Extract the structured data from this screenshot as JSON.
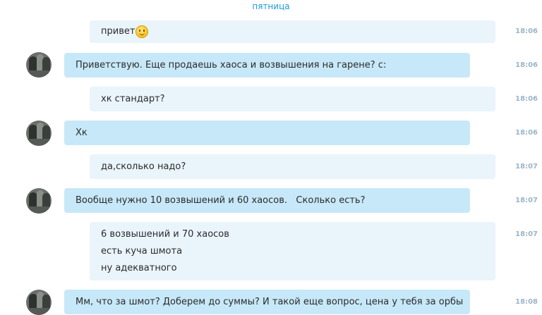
{
  "chat": {
    "date_separator": "пятница",
    "messages": [
      {
        "sender": "me",
        "lines": [
          "привет"
        ],
        "emoji": "smiley-emoji",
        "time": "18:06"
      },
      {
        "sender": "them",
        "lines": [
          "Приветствую. Еще продаешь хаоса и возвышения на гарене? с:"
        ],
        "time": "18:06"
      },
      {
        "sender": "me",
        "lines": [
          "хк стандарт?"
        ],
        "time": "18:06"
      },
      {
        "sender": "them",
        "lines": [
          "Хк"
        ],
        "time": "18:06"
      },
      {
        "sender": "me",
        "lines": [
          "да,сколько надо?"
        ],
        "time": "18:07"
      },
      {
        "sender": "them",
        "lines": [
          "Вообще нужно 10 возвышений и 60 хаосов.   Сколько есть?"
        ],
        "time": "18:07"
      },
      {
        "sender": "me",
        "lines": [
          "6 возвышений и 70 хаосов",
          "есть куча шмота",
          "ну адекватного"
        ],
        "time": "18:07"
      },
      {
        "sender": "them",
        "lines": [
          "Мм, что за шмот? Доберем до суммы? И такой еще вопрос, цена у тебя за орбы"
        ],
        "time": "18:08"
      }
    ]
  },
  "colors": {
    "my_bubble": "#eaf4fb",
    "their_bubble": "#c7e8f8",
    "timestamp": "#9bb5c7",
    "date_separator": "#1c9ad6"
  }
}
